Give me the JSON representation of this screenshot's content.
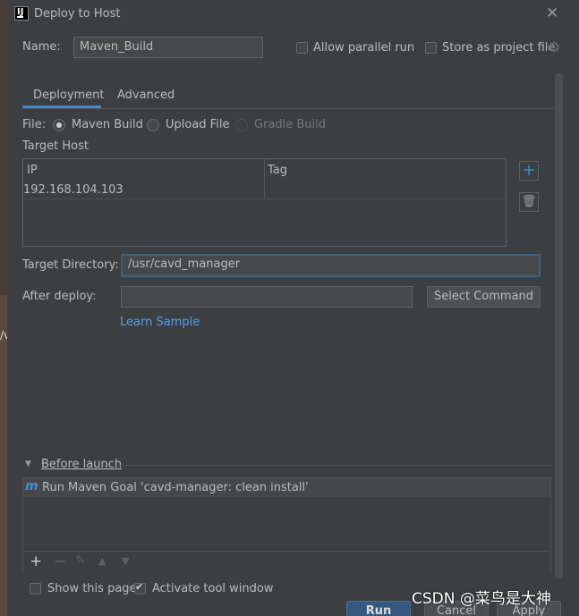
{
  "window": {
    "title": "Deploy to Host",
    "close_glyph": "✕"
  },
  "header": {
    "name_label": "Name:",
    "name_value": "Maven_Build",
    "allow_parallel_label": "Allow parallel run",
    "allow_parallel_checked": false,
    "store_project_label": "Store as project file",
    "store_project_checked": false
  },
  "tabs": [
    {
      "label": "Deployment",
      "selected": true
    },
    {
      "label": "Advanced",
      "selected": false
    }
  ],
  "file": {
    "label": "File:",
    "options": [
      {
        "label": "Maven Build",
        "selected": true,
        "enabled": true
      },
      {
        "label": "Upload File",
        "selected": false,
        "enabled": true
      },
      {
        "label": "Gradle Build",
        "selected": false,
        "enabled": false
      }
    ]
  },
  "target_host": {
    "label": "Target Host",
    "columns": [
      "IP",
      "Tag"
    ],
    "rows": [
      {
        "ip": "192.168.104.103",
        "tag": ""
      }
    ],
    "add_glyph": "+",
    "delete_glyph": "🗑"
  },
  "target_directory": {
    "label": "Target Directory:",
    "value": "/usr/cavd_manager"
  },
  "after_deploy": {
    "label": "After deploy:",
    "value": "",
    "button": "Select Command",
    "link": "Learn Sample"
  },
  "before_launch": {
    "label": "Before launch",
    "tasks": [
      {
        "icon": "m",
        "label": "Run Maven Goal 'cavd-manager: clean install'"
      }
    ],
    "toolbar": {
      "add": "+",
      "remove": "−",
      "edit": "✎",
      "up": "▲",
      "down": "▼"
    }
  },
  "footer": {
    "show_page_label": "Show this page",
    "show_page_checked": false,
    "activate_label": "Activate tool window",
    "activate_checked": true,
    "run": "Run",
    "cancel": "Cancel",
    "apply": "Apply"
  },
  "background": {
    "fragment_text": "/v"
  },
  "watermark": "CSDN @菜鸟是大神"
}
